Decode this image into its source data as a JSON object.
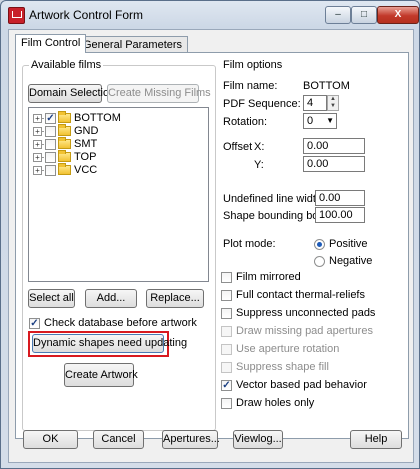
{
  "window": {
    "title": "Artwork Control Form",
    "controls": {
      "minimize": "–",
      "maximize": "□",
      "close": "X"
    }
  },
  "tabs": [
    {
      "label": "Film Control",
      "active": true
    },
    {
      "label": "General Parameters",
      "active": false
    }
  ],
  "available_films": {
    "title": "Available films",
    "domain_selection": "Domain Selection",
    "create_missing": "Create Missing Films",
    "films": [
      {
        "name": "BOTTOM",
        "checked": true,
        "expander": "+"
      },
      {
        "name": "GND",
        "checked": false,
        "expander": "+"
      },
      {
        "name": "SMT",
        "checked": false,
        "expander": "+"
      },
      {
        "name": "TOP",
        "checked": false,
        "expander": "+"
      },
      {
        "name": "VCC",
        "checked": false,
        "expander": "+"
      }
    ],
    "select_all": "Select all",
    "add": "Add...",
    "replace": "Replace...",
    "check_database": "Check database before artwork",
    "check_database_checked": true,
    "dynamic_shapes": "Dynamic shapes need updating",
    "create_artwork": "Create Artwork"
  },
  "film_options": {
    "title": "Film options",
    "film_name_label": "Film name:",
    "film_name": "BOTTOM",
    "pdf_sequence_label": "PDF Sequence:",
    "pdf_sequence": "4",
    "rotation_label": "Rotation:",
    "rotation": "0",
    "offset_label": "Offset",
    "x_label": "X:",
    "x_value": "0.00",
    "y_label": "Y:",
    "y_value": "0.00",
    "undefined_line_width_label": "Undefined line width:",
    "undefined_line_width": "0.00",
    "shape_bounding_box_label": "Shape bounding box:",
    "shape_bounding_box": "100.00",
    "plot_mode_label": "Plot mode:",
    "positive": "Positive",
    "negative": "Negative",
    "plot_mode_selected": "Positive",
    "options": [
      {
        "label": "Film mirrored",
        "checked": false,
        "enabled": true
      },
      {
        "label": "Full contact thermal-reliefs",
        "checked": false,
        "enabled": true
      },
      {
        "label": "Suppress unconnected pads",
        "checked": false,
        "enabled": true
      },
      {
        "label": "Draw missing pad apertures",
        "checked": false,
        "enabled": false
      },
      {
        "label": "Use aperture rotation",
        "checked": false,
        "enabled": false
      },
      {
        "label": "Suppress shape fill",
        "checked": false,
        "enabled": false
      },
      {
        "label": "Vector based pad behavior",
        "checked": true,
        "enabled": true
      },
      {
        "label": "Draw holes only",
        "checked": false,
        "enabled": true
      }
    ]
  },
  "footer": {
    "ok": "OK",
    "cancel": "Cancel",
    "apertures": "Apertures...",
    "viewlog": "Viewlog...",
    "help": "Help"
  },
  "colors": {
    "highlight_box": "#d8191f",
    "accent": "#1d5bb8"
  }
}
